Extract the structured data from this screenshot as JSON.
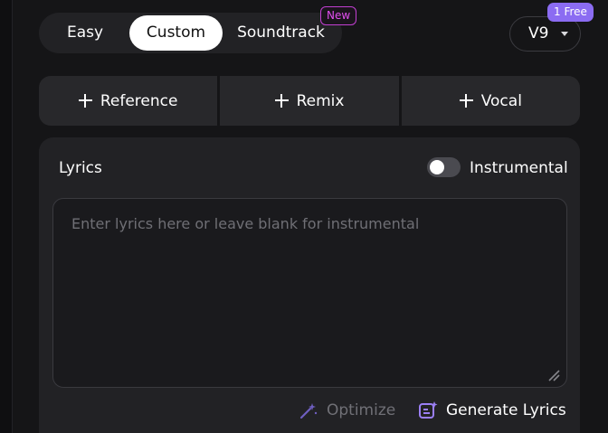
{
  "mode_tabs": [
    {
      "label": "Easy"
    },
    {
      "label": "Custom"
    },
    {
      "label": "Soundtrack"
    }
  ],
  "mode_tabs_active": "Custom",
  "new_badge": "New",
  "version": {
    "label": "V9",
    "badge": "1 Free"
  },
  "actions": [
    {
      "label": "Reference",
      "icon": "plus-icon"
    },
    {
      "label": "Remix",
      "icon": "plus-icon"
    },
    {
      "label": "Vocal",
      "icon": "plus-icon"
    }
  ],
  "lyrics": {
    "title": "Lyrics",
    "instrumental_label": "Instrumental",
    "instrumental_enabled": false,
    "value": "",
    "placeholder": "Enter lyrics here or leave blank for instrumental"
  },
  "footer": {
    "optimize_label": "Optimize",
    "generate_label": "Generate Lyrics"
  },
  "colors": {
    "background": "#151517",
    "panel": "#222225",
    "accent_purple": "#8b6cf2",
    "new_badge": "#e14fef",
    "active_tab": "#ffffff"
  }
}
